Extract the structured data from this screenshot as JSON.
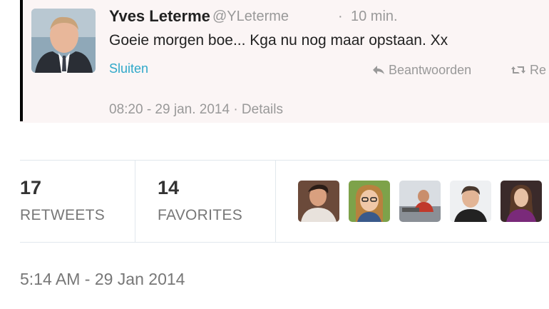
{
  "tweet": {
    "author_name": "Yves Leterme",
    "handle": "@YLeterme",
    "separator": "·",
    "time_ago": "10 min.",
    "text": "Goeie morgen boe... Kga nu nog maar opstaan. Xx",
    "close_label": "Sluiten",
    "reply_label": "Beantwoorden",
    "retweet_label": "Re",
    "date": "08:20 - 29 jan. 2014",
    "details_separator": "·",
    "details_label": "Details"
  },
  "stats": {
    "retweets_count": "17",
    "retweets_label": "RETWEETS",
    "favorites_count": "14",
    "favorites_label": "FAVORITES"
  },
  "favoriters": [
    {
      "name": "user-avatar-1"
    },
    {
      "name": "user-avatar-2"
    },
    {
      "name": "user-avatar-3"
    },
    {
      "name": "user-avatar-4"
    },
    {
      "name": "user-avatar-5"
    }
  ],
  "timestamp": "5:14 AM - 29 Jan 2014",
  "colors": {
    "link": "#2fa8c9",
    "muted": "#999999",
    "card_bg": "#fbf5f5"
  }
}
